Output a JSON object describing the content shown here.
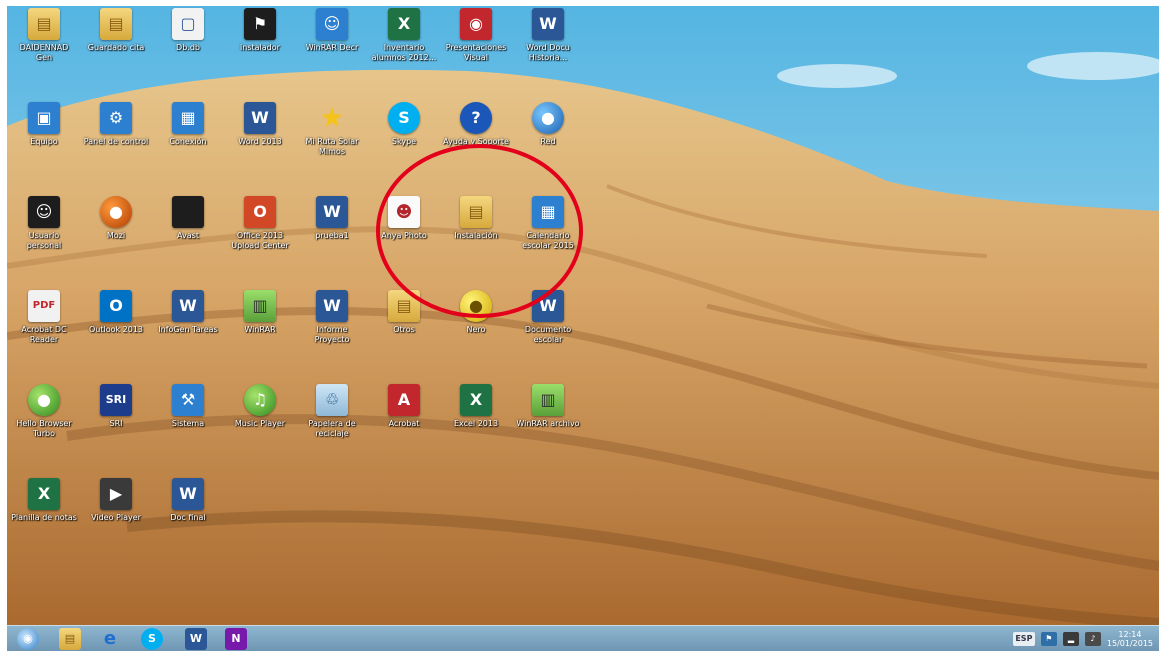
{
  "desktop": {
    "icons": [
      {
        "label": "DAIDENNAD Gen",
        "icon": "folder-user-icon",
        "glyph": "▤",
        "style": "g-folder"
      },
      {
        "label": "Guardado cita",
        "icon": "folder-icon",
        "glyph": "▤",
        "style": "g-folder"
      },
      {
        "label": "Db.db",
        "icon": "file-icon",
        "glyph": "▢",
        "style": "g-doc"
      },
      {
        "label": "instalador",
        "icon": "flag-app-icon",
        "glyph": "⚑",
        "style": "g-dark"
      },
      {
        "label": "WinRAR Decr",
        "icon": "people-app-icon",
        "glyph": "☺",
        "style": "g-app"
      },
      {
        "label": "Inventario alumnos 2012...",
        "icon": "excel-file-icon",
        "glyph": "X",
        "style": "g-excel"
      },
      {
        "label": "Presentaciones Visual",
        "icon": "presentation-app-icon",
        "glyph": "◉",
        "style": "g-red"
      },
      {
        "label": "Word Docu Historia...",
        "icon": "word-file-icon",
        "glyph": "W",
        "style": "g-word"
      },
      {
        "label": "Equipo",
        "icon": "computer-icon",
        "glyph": "▣",
        "style": "g-app"
      },
      {
        "label": "Panel de control",
        "icon": "control-panel-icon",
        "glyph": "⚙",
        "style": "g-app"
      },
      {
        "label": "Conexión",
        "icon": "network-icon",
        "glyph": "▦",
        "style": "g-app"
      },
      {
        "label": "Word 2013",
        "icon": "word-app-icon",
        "glyph": "W",
        "style": "g-word"
      },
      {
        "label": "Mi Ruta Solar Mimos",
        "icon": "star-icon",
        "glyph": "★",
        "style": "g-star"
      },
      {
        "label": "Skype",
        "icon": "skype-icon",
        "glyph": "S",
        "style": "g-skype"
      },
      {
        "label": "Ayuda y Soporte",
        "icon": "help-icon",
        "glyph": "?",
        "style": "g-help"
      },
      {
        "label": "Red",
        "icon": "globe-icon",
        "glyph": "●",
        "style": "g-globe"
      },
      {
        "label": "Usuario personal",
        "icon": "user-settings-icon",
        "glyph": "☺",
        "style": "g-dark"
      },
      {
        "label": "Mozi",
        "icon": "firefox-icon",
        "glyph": "●",
        "style": "g-orange"
      },
      {
        "label": "Avast",
        "icon": "blank-icon",
        "glyph": "",
        "style": "g-dark"
      },
      {
        "label": "Office 2013 Upload Center",
        "icon": "office-icon",
        "glyph": "O",
        "style": "g-office"
      },
      {
        "label": "prueba1",
        "icon": "word-file-icon",
        "glyph": "W",
        "style": "g-word"
      },
      {
        "label": "Anya Photo",
        "icon": "person-photo-icon",
        "glyph": "☻",
        "style": "g-person"
      },
      {
        "label": "Instalación",
        "icon": "folder-icon",
        "glyph": "▤",
        "style": "g-folder"
      },
      {
        "label": "Calendario escolar 2015",
        "icon": "calendar-app-icon",
        "glyph": "▦",
        "style": "g-app"
      },
      {
        "label": "Acrobat DC Reader",
        "icon": "pdf-reader-icon",
        "glyph": "PDF",
        "style": "g-pdf"
      },
      {
        "label": "Outlook 2013",
        "icon": "outlook-icon",
        "glyph": "O",
        "style": "g-outlook"
      },
      {
        "label": "InfoGen Tareas",
        "icon": "word-file-icon",
        "glyph": "W",
        "style": "g-word"
      },
      {
        "label": "WinRAR",
        "icon": "archive-icon",
        "glyph": "▥",
        "style": "g-archive"
      },
      {
        "label": "Informe Proyecto",
        "icon": "word-file-icon",
        "glyph": "W",
        "style": "g-word"
      },
      {
        "label": "Otros",
        "icon": "folder-icon",
        "glyph": "▤",
        "style": "g-folder"
      },
      {
        "label": "Nero",
        "icon": "disc-icon",
        "glyph": "●",
        "style": "g-yellow"
      },
      {
        "label": "Documento escolar",
        "icon": "word-file-icon",
        "glyph": "W",
        "style": "g-word"
      },
      {
        "label": "Hello Browser Turbo",
        "icon": "green-app-icon",
        "glyph": "●",
        "style": "g-green"
      },
      {
        "label": "SRI",
        "icon": "sri-icon",
        "glyph": "SRI",
        "style": "g-sri"
      },
      {
        "label": "Sistema",
        "icon": "tools-icon",
        "glyph": "⚒",
        "style": "g-app"
      },
      {
        "label": "Music Player",
        "icon": "music-icon",
        "glyph": "♫",
        "style": "g-green"
      },
      {
        "label": "Papelera de reciclaje",
        "icon": "recycle-bin-icon",
        "glyph": "♲",
        "style": "g-recycle"
      },
      {
        "label": "Acrobat",
        "icon": "acrobat-icon",
        "glyph": "A",
        "style": "g-red"
      },
      {
        "label": "Excel 2013",
        "icon": "excel-app-icon",
        "glyph": "X",
        "style": "g-excel"
      },
      {
        "label": "WinRAR archivo",
        "icon": "archive-icon",
        "glyph": "▥",
        "style": "g-archive"
      },
      {
        "label": "Planilla de notas",
        "icon": "excel-file-icon",
        "glyph": "X",
        "style": "g-excel"
      },
      {
        "label": "Video Player",
        "icon": "video-icon",
        "glyph": "▶",
        "style": "g-film"
      },
      {
        "label": "Doc final",
        "icon": "word-file-icon",
        "glyph": "W",
        "style": "g-word"
      }
    ]
  },
  "taskbar": {
    "apps": [
      {
        "name": "start-button",
        "glyph": "◉"
      },
      {
        "name": "file-explorer-icon",
        "glyph": "▤"
      },
      {
        "name": "internet-explorer-icon",
        "glyph": "e"
      },
      {
        "name": "skype-taskbar-icon",
        "glyph": "S"
      },
      {
        "name": "word-taskbar-icon",
        "glyph": "W"
      },
      {
        "name": "onenote-taskbar-icon",
        "glyph": "N"
      }
    ],
    "tray": {
      "keyboard": "ESP",
      "time": "12:14",
      "date": "15/01/2015"
    }
  },
  "colors": {
    "highlight": "#e3001b",
    "taskbar": "#7aa2be",
    "sky": "#8fd0ec",
    "sand": "#c98d51"
  }
}
